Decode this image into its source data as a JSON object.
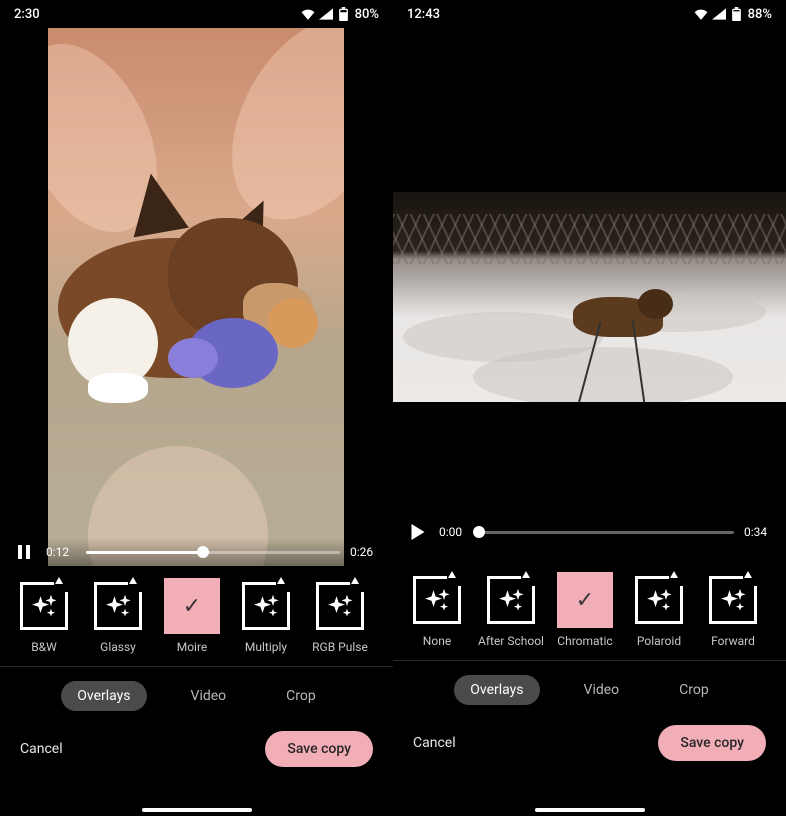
{
  "left": {
    "status_time": "2:30",
    "status_battery": "80%",
    "video": {
      "playing": true,
      "current_time": "0:12",
      "duration": "0:26",
      "progress_pct": 46
    },
    "effects": [
      {
        "label": "B&W",
        "selected": false
      },
      {
        "label": "Glassy",
        "selected": false
      },
      {
        "label": "Moire",
        "selected": true
      },
      {
        "label": "Multiply",
        "selected": false
      },
      {
        "label": "RGB Pulse",
        "selected": false
      }
    ],
    "tabs": [
      {
        "label": "Overlays",
        "active": true
      },
      {
        "label": "Video",
        "active": false
      },
      {
        "label": "Crop",
        "active": false
      }
    ],
    "cancel": "Cancel",
    "save": "Save copy"
  },
  "right": {
    "status_time": "12:43",
    "status_battery": "88%",
    "video": {
      "playing": false,
      "current_time": "0:00",
      "duration": "0:34",
      "progress_pct": 0
    },
    "effects": [
      {
        "label": "None",
        "selected": false
      },
      {
        "label": "After School",
        "selected": false
      },
      {
        "label": "Chromatic",
        "selected": true
      },
      {
        "label": "Polaroid",
        "selected": false
      },
      {
        "label": "Forward",
        "selected": false
      }
    ],
    "tabs": [
      {
        "label": "Overlays",
        "active": true
      },
      {
        "label": "Video",
        "active": false
      },
      {
        "label": "Crop",
        "active": false
      }
    ],
    "cancel": "Cancel",
    "save": "Save copy"
  }
}
